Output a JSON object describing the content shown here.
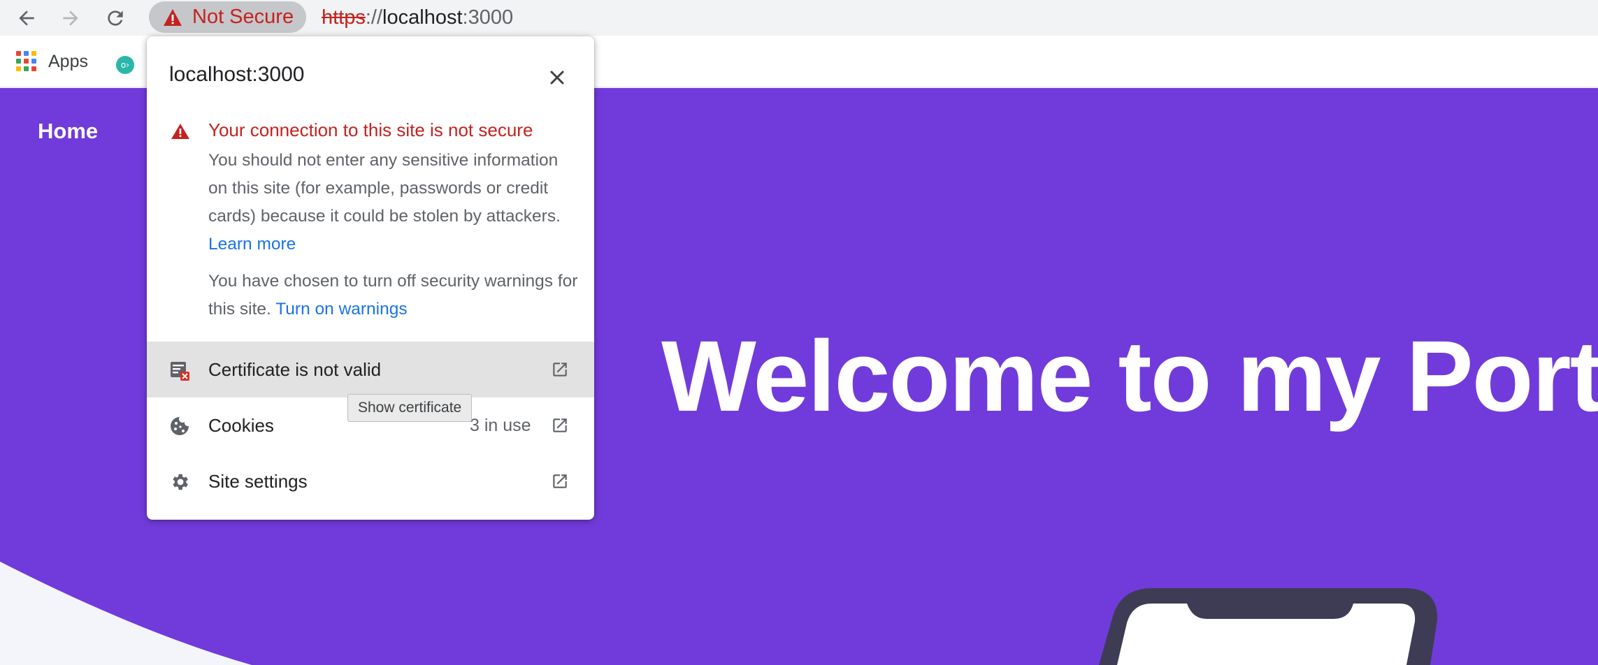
{
  "toolbar": {
    "back_icon": "arrow-left-icon",
    "forward_icon": "arrow-right-icon",
    "reload_icon": "reload-icon",
    "security_chip": {
      "label": "Not Secure",
      "icon": "warning-icon",
      "color": "#c5221f"
    },
    "url": {
      "scheme": "https",
      "separator": "://",
      "host": "localhost",
      "port": ":3000"
    }
  },
  "bookmarks": {
    "apps_label": "Apps",
    "favicon_text": "o›"
  },
  "page": {
    "nav_home": "Home",
    "hero_title": "Welcome to my Portfo",
    "background": "#713bdb"
  },
  "popup": {
    "host": "localhost:3000",
    "close_icon": "close-icon",
    "warning_title": "Your connection to this site is not secure",
    "warning_body": "You should not enter any sensitive information on this site (for example, passwords or credit cards) because it could be stolen by attackers.",
    "learn_more": "Learn more",
    "warnings_body": "You have chosen to turn off security warnings for this site.",
    "turn_on_warnings": "Turn on warnings",
    "rows": [
      {
        "label": "Certificate is not valid",
        "icon": "certificate-invalid-icon",
        "count": ""
      },
      {
        "label": "Cookies",
        "icon": "cookie-icon",
        "count": "3 in use"
      },
      {
        "label": "Site settings",
        "icon": "gear-icon",
        "count": ""
      }
    ],
    "tooltip": "Show certificate"
  }
}
